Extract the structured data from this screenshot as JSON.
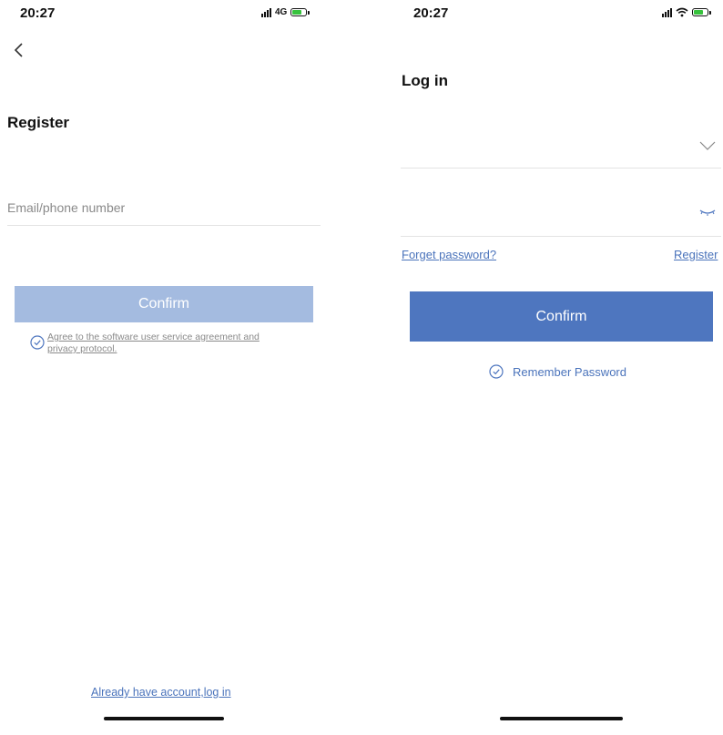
{
  "register_screen": {
    "status_bar": {
      "time": "20:27",
      "network": "4G"
    },
    "title": "Register",
    "email_field": {
      "placeholder": "Email/phone number",
      "value": ""
    },
    "confirm_label": "Confirm",
    "agreement_line1": "Agree to the software user service agreement and",
    "agreement_line2": "privacy protocol.",
    "login_link": "Already have account,log in",
    "colors": {
      "confirm_disabled": "#a4bbe0",
      "link": "#4a73bb"
    },
    "icons": [
      "back-chevron-icon",
      "check-circle-icon",
      "signal-icon",
      "battery-icon"
    ]
  },
  "login_screen": {
    "status_bar": {
      "time": "20:27"
    },
    "title": "Log in",
    "account_field": {
      "placeholder": "",
      "value": ""
    },
    "password_field": {
      "placeholder": "",
      "value": ""
    },
    "forget_password": "Forget password?",
    "register_link": "Register",
    "confirm_label": "Confirm",
    "remember_password": "Remember Password",
    "colors": {
      "confirm": "#4e76bf",
      "link": "#4a73bb"
    },
    "icons": [
      "chevron-down-icon",
      "eye-closed-icon",
      "check-circle-icon",
      "wifi-icon",
      "signal-icon",
      "battery-icon"
    ]
  }
}
